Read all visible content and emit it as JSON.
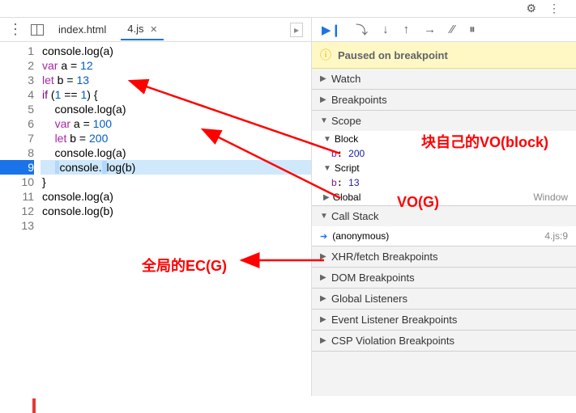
{
  "topbar": {
    "settings": "⚙",
    "menu": "⋮"
  },
  "tabs": {
    "menu": "⋮",
    "file1": "index.html",
    "file2": "4.js",
    "close": "✕"
  },
  "code": {
    "lines": [
      {
        "n": "1",
        "html": "console.log(a)"
      },
      {
        "n": "2",
        "html": "<span class='var-kw'>var</span> a = <span class='num'>12</span>"
      },
      {
        "n": "3",
        "html": "<span class='var-kw'>let</span> b = <span class='num'>13</span>"
      },
      {
        "n": "4",
        "html": "<span class='kw'>if</span> (<span class='num'>1</span> == <span class='num'>1</span>) {"
      },
      {
        "n": "5",
        "html": "    console.log(a)"
      },
      {
        "n": "6",
        "html": "    <span class='var-kw'>var</span> a = <span class='num'>100</span>"
      },
      {
        "n": "7",
        "html": "    <span class='var-kw'>let</span> b = <span class='num'>200</span>"
      },
      {
        "n": "8",
        "html": "    console.log(a)"
      },
      {
        "n": "9",
        "html": "    <span class='pb'> </span>console.<span class='pb'> </span>log(b)",
        "hl": true
      },
      {
        "n": "10",
        "html": "}"
      },
      {
        "n": "11",
        "html": "console.log(a)"
      },
      {
        "n": "12",
        "html": "console.log(b)"
      },
      {
        "n": "13",
        "html": ""
      }
    ]
  },
  "debugger": {
    "paused_msg": "Paused on breakpoint",
    "sections": {
      "watch": "Watch",
      "breakpoints": "Breakpoints",
      "scope": "Scope",
      "block": "Block",
      "block_var": {
        "name": "b",
        "val": "200"
      },
      "script": "Script",
      "script_var": {
        "name": "b",
        "val": "13"
      },
      "global": "Global",
      "global_val": "Window",
      "callstack": "Call Stack",
      "cs_frame": "(anonymous)",
      "cs_loc": "4.js:9",
      "xhr": "XHR/fetch Breakpoints",
      "dom": "DOM Breakpoints",
      "listeners": "Global Listeners",
      "events": "Event Listener Breakpoints",
      "csp": "CSP Violation Breakpoints"
    }
  },
  "annotations": {
    "a1": "块自己的VO(block)",
    "a2": "VO(G)",
    "a3": "全局的EC(G)"
  }
}
